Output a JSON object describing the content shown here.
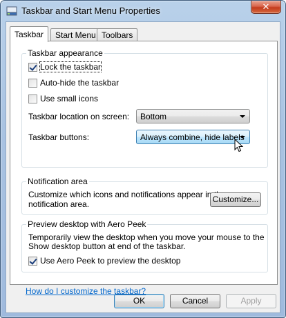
{
  "window": {
    "title": "Taskbar and Start Menu Properties",
    "close_label": "✕"
  },
  "tabs": [
    {
      "label": "Taskbar",
      "active": true
    },
    {
      "label": "Start Menu",
      "active": false
    },
    {
      "label": "Toolbars",
      "active": false
    }
  ],
  "taskbar_appearance": {
    "title": "Taskbar appearance",
    "lock_taskbar": {
      "label": "Lock the taskbar",
      "checked": true
    },
    "auto_hide": {
      "label": "Auto-hide the taskbar",
      "checked": false
    },
    "small_icons": {
      "label": "Use small icons",
      "checked": false
    },
    "location_label": "Taskbar location on screen:",
    "location_value": "Bottom",
    "buttons_label": "Taskbar buttons:",
    "buttons_value": "Always combine, hide labels"
  },
  "notification_area": {
    "title": "Notification area",
    "description_line1": "Customize which icons and notifications appear in the",
    "description_line2": "notification area.",
    "customize_button": "Customize..."
  },
  "aero_peek": {
    "title": "Preview desktop with Aero Peek",
    "description_line1": "Temporarily view the desktop when you move your mouse to the",
    "description_line2": "Show desktop button at end of the taskbar.",
    "use_aero_peek": {
      "label": "Use Aero Peek to preview the desktop",
      "checked": true
    }
  },
  "help_link": "How do I customize the taskbar?",
  "buttons": {
    "ok": "OK",
    "cancel": "Cancel",
    "apply": "Apply"
  },
  "colors": {
    "link": "#0066cc",
    "focus_border": "#3c7fb1",
    "close_button": "#c33b1d"
  }
}
